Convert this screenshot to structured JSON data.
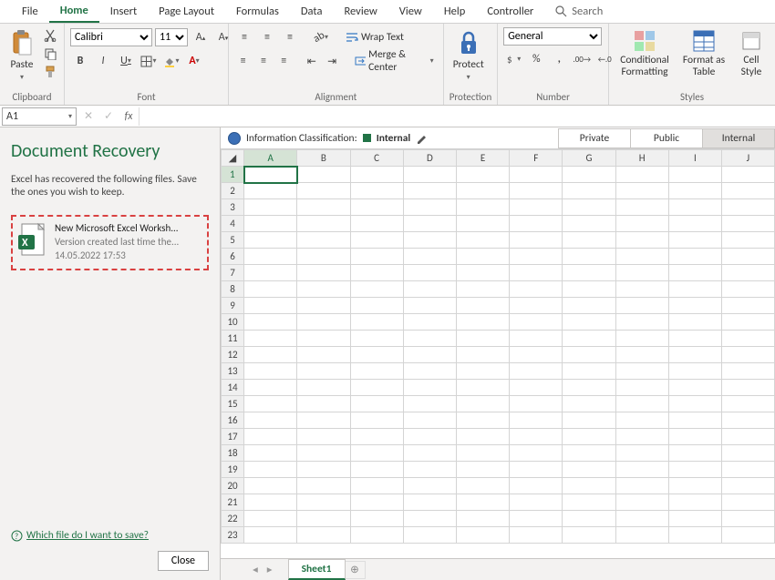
{
  "tabs": [
    "File",
    "Home",
    "Insert",
    "Page Layout",
    "Formulas",
    "Data",
    "Review",
    "View",
    "Help",
    "Controller"
  ],
  "active_tab": "Home",
  "search_label": "Search",
  "ribbon": {
    "clipboard": {
      "paste": "Paste",
      "label": "Clipboard"
    },
    "font": {
      "name": "Calibri",
      "size": "11",
      "label": "Font",
      "bold": "B",
      "italic": "I",
      "underline": "U"
    },
    "alignment": {
      "wrap": "Wrap Text",
      "merge": "Merge & Center",
      "label": "Alignment"
    },
    "protection": {
      "protect": "Protect",
      "label": "Protection"
    },
    "number": {
      "format": "General",
      "label": "Number",
      "percent": "%",
      "comma": ","
    },
    "styles": {
      "cond": "Conditional Formatting",
      "table": "Format as Table",
      "cell": "Cell Style",
      "label": "Styles"
    }
  },
  "formula_bar": {
    "cell": "A1",
    "fx": "fx"
  },
  "recovery": {
    "title": "Document Recovery",
    "desc": "Excel has recovered the following files.  Save the ones you wish to keep.",
    "item": {
      "title": "New Microsoft Excel Worksh...",
      "sub": "Version created last time the...",
      "time": "14.05.2022 17:53"
    },
    "link": "Which file do I want to save?",
    "close": "Close"
  },
  "classification": {
    "label": "Information Classification:",
    "value": "Internal",
    "options": [
      "Private",
      "Public",
      "Internal"
    ],
    "active": "Internal"
  },
  "grid": {
    "cols": [
      "A",
      "B",
      "C",
      "D",
      "E",
      "F",
      "G",
      "H",
      "I",
      "J"
    ],
    "rows": 23,
    "selected": "A1"
  },
  "sheets": {
    "active": "Sheet1"
  }
}
